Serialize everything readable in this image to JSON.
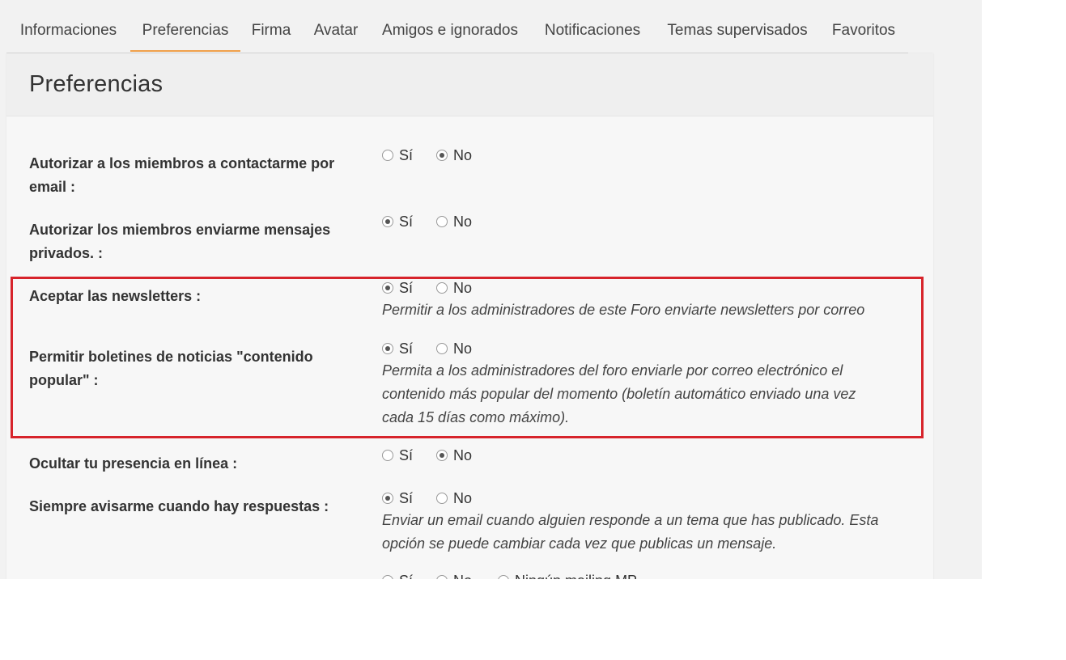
{
  "tabs": [
    {
      "label": "Informaciones"
    },
    {
      "label": "Preferencias",
      "active": true
    },
    {
      "label": "Firma"
    },
    {
      "label": "Avatar"
    },
    {
      "label": "Amigos e ignorados"
    },
    {
      "label": "Notificaciones"
    },
    {
      "label": "Temas supervisados"
    },
    {
      "label": "Favoritos"
    }
  ],
  "panel": {
    "title": "Preferencias"
  },
  "settings": [
    {
      "label_line1": "Autorizar a los miembros a contactarme por",
      "label_line2": "email :",
      "yes": "Sí",
      "no": "No",
      "selected": "No"
    },
    {
      "label_line1": "Autorizar los miembros enviarme mensajes",
      "label_line2": "privados. :",
      "yes": "Sí",
      "no": "No",
      "selected": "Sí"
    },
    {
      "label_line1": "Aceptar las newsletters :",
      "yes": "Sí",
      "no": "No",
      "selected": "Sí",
      "help_line1": "Permitir a los administradores de este Foro enviarte newsletters por correo"
    },
    {
      "label_line1": "Permitir boletines de noticias \"contenido",
      "label_line2": "popular\" :",
      "yes": "Sí",
      "no": "No",
      "selected": "Sí",
      "help_line1": "Permita a los administradores del foro enviarle por correo electrónico el",
      "help_line2": "contenido más popular del momento (boletín automático enviado una vez",
      "help_line3": "cada 15 días como máximo)."
    },
    {
      "label_line1": "Ocultar tu presencia en línea :",
      "yes": "Sí",
      "no": "No",
      "selected": "No"
    },
    {
      "label_line1": "Siempre avisarme cuando hay respuestas :",
      "yes": "Sí",
      "no": "No",
      "selected": "Sí",
      "help_line1": "Enviar un email cuando alguien responde a un tema que has publicado. Esta",
      "help_line2": "opción se puede cambiar cada vez que publicas un mensaje."
    },
    {
      "yes": "Sí",
      "no": "No",
      "third": "Ningún mailing MP"
    }
  ],
  "colors": {
    "accent_tab": "#f0a04a",
    "highlight_box": "#d7242b"
  }
}
